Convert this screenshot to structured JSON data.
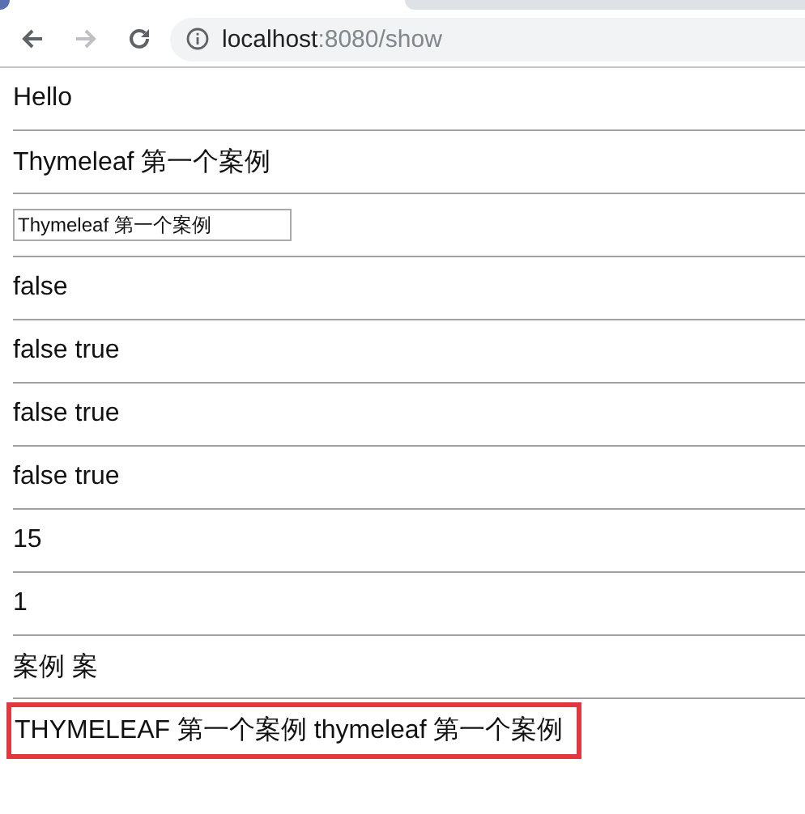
{
  "browser": {
    "url_host": "localhost",
    "url_path": ":8080/show"
  },
  "rows": [
    {
      "kind": "text",
      "text": "Hello",
      "highlighted": false
    },
    {
      "kind": "text",
      "text": "Thymeleaf 第一个案例",
      "highlighted": false
    },
    {
      "kind": "input",
      "value": "Thymeleaf 第一个案例",
      "highlighted": false
    },
    {
      "kind": "text",
      "text": "false",
      "highlighted": false
    },
    {
      "kind": "text",
      "text": "false true",
      "highlighted": false
    },
    {
      "kind": "text",
      "text": "false true",
      "highlighted": false
    },
    {
      "kind": "text",
      "text": "false true",
      "highlighted": false
    },
    {
      "kind": "text",
      "text": "15",
      "highlighted": false
    },
    {
      "kind": "text",
      "text": "1",
      "highlighted": false
    },
    {
      "kind": "text",
      "text": "案例 案",
      "highlighted": false
    },
    {
      "kind": "text",
      "text": "THYMELEAF 第一个案例 thymeleaf 第一个案例",
      "highlighted": true
    }
  ]
}
